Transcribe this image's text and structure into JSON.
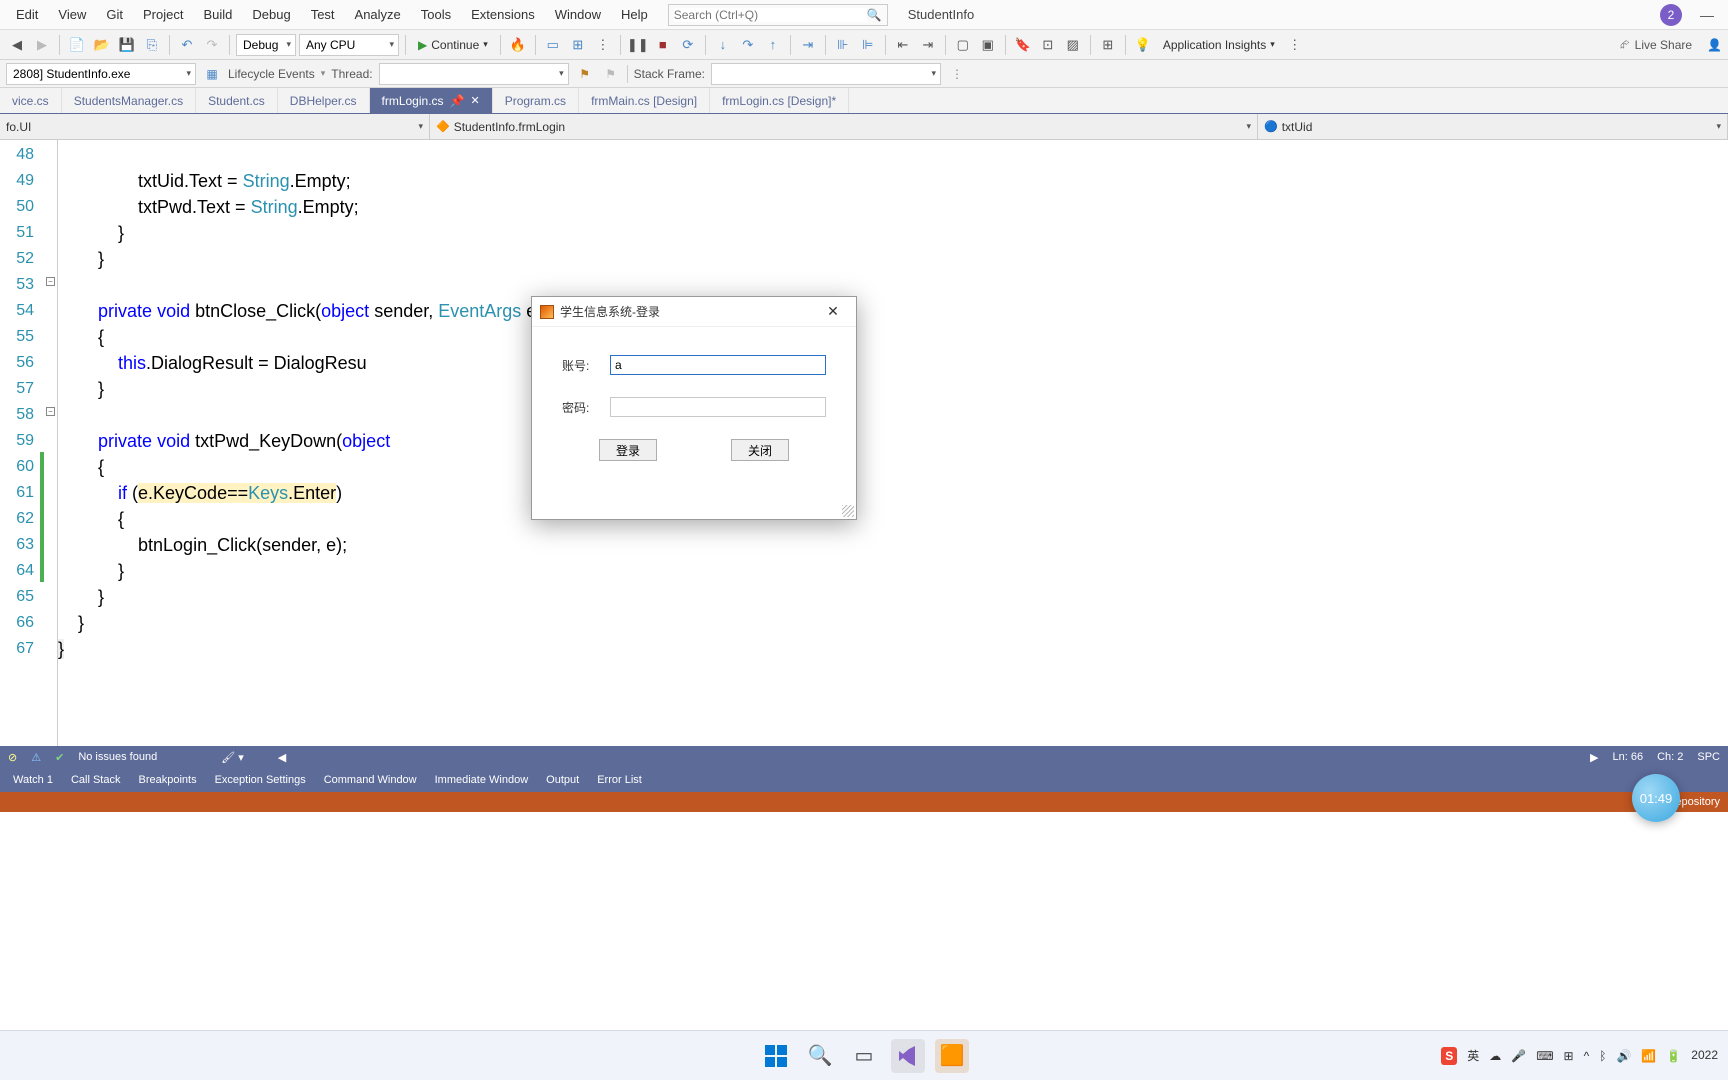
{
  "menu": {
    "items": [
      "Edit",
      "View",
      "Git",
      "Project",
      "Build",
      "Debug",
      "Test",
      "Analyze",
      "Tools",
      "Extensions",
      "Window",
      "Help"
    ],
    "search_placeholder": "Search (Ctrl+Q)",
    "app_name": "StudentInfo",
    "user_badge": "2"
  },
  "toolbar": {
    "config": "Debug",
    "platform": "Any CPU",
    "continue": "Continue",
    "insights": "Application Insights",
    "live_share": "Live Share"
  },
  "toolbar2": {
    "process": "2808] StudentInfo.exe",
    "lifecycle": "Lifecycle Events",
    "thread_label": "Thread:",
    "stack_label": "Stack Frame:"
  },
  "tabs": [
    {
      "label": "vice.cs",
      "active": false
    },
    {
      "label": "StudentsManager.cs",
      "active": false
    },
    {
      "label": "Student.cs",
      "active": false
    },
    {
      "label": "DBHelper.cs",
      "active": false
    },
    {
      "label": "frmLogin.cs",
      "active": true
    },
    {
      "label": "Program.cs",
      "active": false
    },
    {
      "label": "frmMain.cs [Design]",
      "active": false
    },
    {
      "label": "frmLogin.cs [Design]*",
      "active": false
    }
  ],
  "nav": {
    "ns": "fo.UI",
    "cls": "StudentInfo.frmLogin",
    "member": "txtUid"
  },
  "lines": {
    "start": 48,
    "end": 67
  },
  "dialog": {
    "title": "学生信息系统-登录",
    "account_label": "账号:",
    "password_label": "密码:",
    "account_value": "a",
    "login_btn": "登录",
    "close_btn": "关闭"
  },
  "status": {
    "issues": "No issues found",
    "ln": "Ln: 66",
    "ch": "Ch: 2",
    "spc": "SPC"
  },
  "panels": [
    "Watch 1",
    "Call Stack",
    "Breakpoints",
    "Exception Settings",
    "Command Window",
    "Immediate Window",
    "Output",
    "Error List"
  ],
  "status2": {
    "repo": "Repository",
    "year": "2022"
  },
  "clock": "01:49",
  "ime": "英"
}
